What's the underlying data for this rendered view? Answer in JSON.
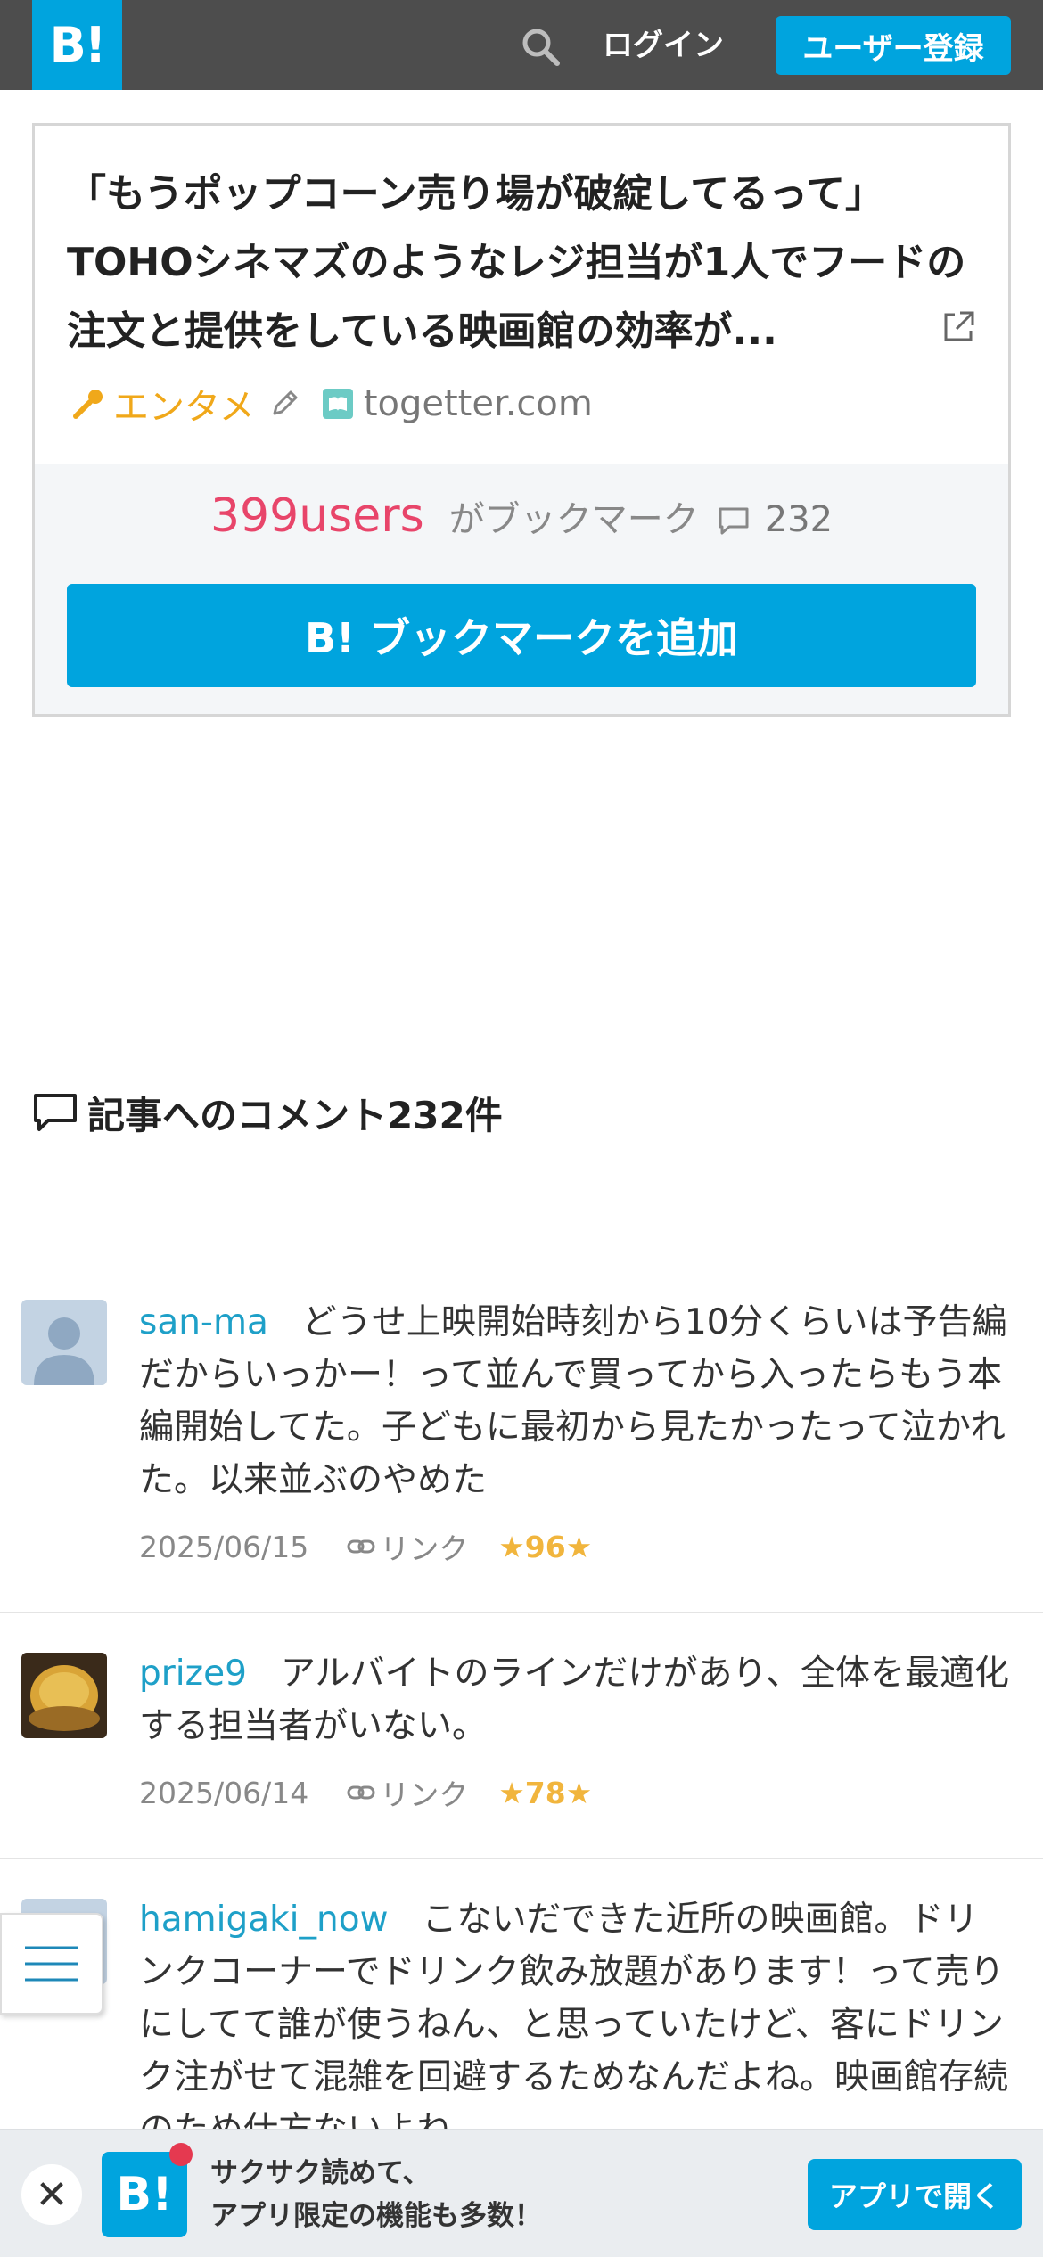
{
  "header": {
    "logo_text": "B!",
    "login_label": "ログイン",
    "register_label": "ユーザー登録"
  },
  "entry": {
    "title": "「もうポップコーン売り場が破綻してるって」TOHOシネマズのようなレジ担当が1人でフードの注文と提供をしている映画館の効率が...",
    "category": "エンタメ",
    "domain": "togetter.com",
    "users_count": "399users",
    "users_suffix": "がブックマーク",
    "comment_count": "232",
    "add_bookmark_label": "B! ブックマークを追加"
  },
  "comments_section": {
    "heading": "記事へのコメント232件"
  },
  "comments": [
    {
      "user": "san-ma",
      "text": "どうせ上映開始時刻から10分くらいは予告編だからいっかー！って並んで買ってから入ったらもう本編開始してた。子どもに最初から見たかったって泣かれた。以来並ぶのやめた",
      "date": "2025/06/15",
      "link_label": "リンク",
      "stars": "★96★"
    },
    {
      "user": "prize9",
      "text": "アルバイトのラインだけがあり、全体を最適化する担当者がいない。",
      "date": "2025/06/14",
      "link_label": "リンク",
      "stars": "★78★"
    },
    {
      "user": "hamigaki_now",
      "text": "こないだできた近所の映画館。ドリンクコーナーでドリンク飲み放題があります！って売りにしてて誰が使うねん、と思っていたけど、客にドリンク注がせて混雑を回避するためなんだよね。映画館存続のため仕方ないよね。",
      "date": "",
      "link_label": "",
      "stars": ""
    }
  ],
  "app_banner": {
    "close_symbol": "✕",
    "icon_text": "B!",
    "line1": "サクサク読めて、",
    "line2": "アプリ限定の機能も多数！",
    "open_label": "アプリで開く"
  },
  "colors": {
    "header_bg": "#4d4d4d",
    "brand_blue": "#00a4de",
    "users_pink": "#e8456a",
    "star_gold": "#f1b53d",
    "category_orange": "#f0a81a"
  },
  "icons": [
    "search-icon",
    "external-link-icon",
    "microphone-icon",
    "pencil-icon",
    "site-favicon",
    "comment-icon",
    "link-icon",
    "menu-icon",
    "close-icon"
  ]
}
